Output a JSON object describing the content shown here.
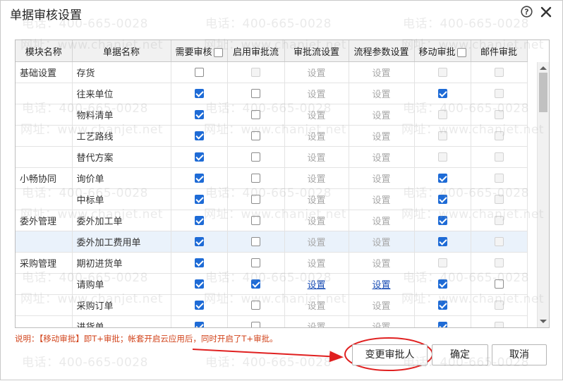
{
  "dialog": {
    "title": "单据审核设置"
  },
  "columns": [
    "模块名称",
    "单据名称",
    "需要审核",
    "启用审批流",
    "审批流设置",
    "流程参数设置",
    "移动审批",
    "邮件审批"
  ],
  "rows": [
    {
      "module": "基础设置",
      "doc": "存货",
      "need": "unchecked",
      "flow": "disabled",
      "flow_link": "设置",
      "param_link": "设置",
      "links_active": false,
      "mobile": "disabled",
      "mail": "disabled"
    },
    {
      "module": "",
      "doc": "往来单位",
      "need": "checked",
      "flow": "unchecked",
      "flow_link": "设置",
      "param_link": "设置",
      "links_active": false,
      "mobile": "checked",
      "mail": "disabled"
    },
    {
      "module": "",
      "doc": "物料清单",
      "need": "checked",
      "flow": "unchecked",
      "flow_link": "设置",
      "param_link": "设置",
      "links_active": false,
      "mobile": "disabled",
      "mail": "disabled"
    },
    {
      "module": "",
      "doc": "工艺路线",
      "need": "checked",
      "flow": "unchecked",
      "flow_link": "设置",
      "param_link": "设置",
      "links_active": false,
      "mobile": "disabled",
      "mail": "disabled"
    },
    {
      "module": "",
      "doc": "替代方案",
      "need": "checked",
      "flow": "unchecked",
      "flow_link": "设置",
      "param_link": "设置",
      "links_active": false,
      "mobile": "disabled",
      "mail": "disabled"
    },
    {
      "module": "小畅协同",
      "doc": "询价单",
      "need": "checked",
      "flow": "unchecked",
      "flow_link": "设置",
      "param_link": "设置",
      "links_active": false,
      "mobile": "checked",
      "mail": "disabled"
    },
    {
      "module": "",
      "doc": "中标单",
      "need": "checked",
      "flow": "unchecked",
      "flow_link": "设置",
      "param_link": "设置",
      "links_active": false,
      "mobile": "checked",
      "mail": "disabled"
    },
    {
      "module": "委外管理",
      "doc": "委外加工单",
      "need": "checked",
      "flow": "unchecked",
      "flow_link": "设置",
      "param_link": "设置",
      "links_active": false,
      "mobile": "checked",
      "mail": "disabled"
    },
    {
      "module": "",
      "doc": "委外加工费用单",
      "need": "checked",
      "flow": "unchecked",
      "flow_link": "设置",
      "param_link": "设置",
      "links_active": false,
      "mobile": "checked",
      "mail": "disabled"
    },
    {
      "module": "采购管理",
      "doc": "期初进货单",
      "need": "checked",
      "flow": "unchecked",
      "flow_link": "设置",
      "param_link": "设置",
      "links_active": false,
      "mobile": "disabled",
      "mail": "disabled"
    },
    {
      "module": "",
      "doc": "请购单",
      "need": "checked",
      "flow": "checked",
      "flow_link": "设置",
      "param_link": "设置",
      "links_active": true,
      "mobile": "checked",
      "mail": "unchecked"
    },
    {
      "module": "",
      "doc": "采购订单",
      "need": "checked",
      "flow": "unchecked",
      "flow_link": "设置",
      "param_link": "设置",
      "links_active": false,
      "mobile": "checked",
      "mail": "disabled"
    },
    {
      "module": "",
      "doc": "进货单",
      "need": "checked",
      "flow": "unchecked",
      "flow_link": "设置",
      "param_link": "设置",
      "links_active": false,
      "mobile": "checked",
      "mail": "disabled"
    }
  ],
  "highlighted_row": 8,
  "note": "说明：【移动审批】即T+审批；帐套开启云应用后，同时开启了T+审批。",
  "buttons": {
    "change_approver": "变更审批人",
    "ok": "确定",
    "cancel": "取消"
  },
  "watermark": {
    "phone": "电话：400-665-0028",
    "site": "网址：www.chanjet.net"
  },
  "colors": {
    "accent": "#1e6bd6",
    "annotation": "#e02020",
    "note": "#d2451d",
    "link": "#1c4fb5"
  },
  "icons": [
    "help-icon",
    "close-icon"
  ]
}
